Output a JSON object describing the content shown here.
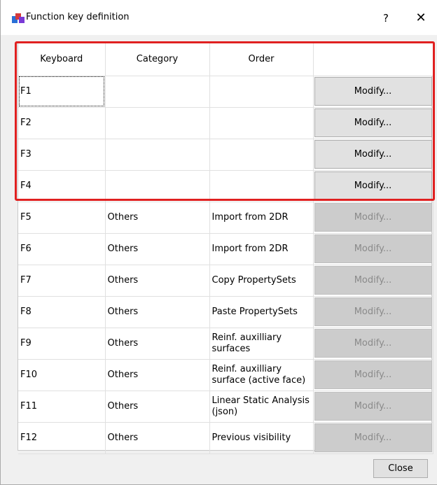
{
  "window": {
    "title": "Function key definition",
    "help_label": "?",
    "close_glyph": "✕"
  },
  "table": {
    "headers": [
      "Keyboard",
      "Category",
      "Order",
      ""
    ],
    "rows": [
      {
        "key": "F1",
        "category": "",
        "order": "",
        "button": "Modify...",
        "enabled": true
      },
      {
        "key": "F2",
        "category": "",
        "order": "",
        "button": "Modify...",
        "enabled": true
      },
      {
        "key": "F3",
        "category": "",
        "order": "",
        "button": "Modify...",
        "enabled": true
      },
      {
        "key": "F4",
        "category": "",
        "order": "",
        "button": "Modify...",
        "enabled": true
      },
      {
        "key": "F5",
        "category": "Others",
        "order": "Import from 2DR",
        "button": "Modify...",
        "enabled": false
      },
      {
        "key": "F6",
        "category": "Others",
        "order": "Import from 2DR",
        "button": "Modify...",
        "enabled": false
      },
      {
        "key": "F7",
        "category": "Others",
        "order": "Copy PropertySets",
        "button": "Modify...",
        "enabled": false
      },
      {
        "key": "F8",
        "category": "Others",
        "order": "Paste PropertySets",
        "button": "Modify...",
        "enabled": false
      },
      {
        "key": "F9",
        "category": "Others",
        "order": "Reinf. auxilliary surfaces",
        "button": "Modify...",
        "enabled": false
      },
      {
        "key": "F10",
        "category": "Others",
        "order": "Reinf. auxilliary surface (active face)",
        "button": "Modify...",
        "enabled": false
      },
      {
        "key": "F11",
        "category": "Others",
        "order": "Linear Static Analysis (json)",
        "button": "Modify...",
        "enabled": false
      },
      {
        "key": "F12",
        "category": "Others",
        "order": "Previous visibility",
        "button": "Modify...",
        "enabled": false
      }
    ]
  },
  "footer": {
    "close_label": "Close"
  },
  "colors": {
    "highlight": "#e02020",
    "button_face": "#e1e1e1",
    "button_disabled": "#cccccc"
  }
}
